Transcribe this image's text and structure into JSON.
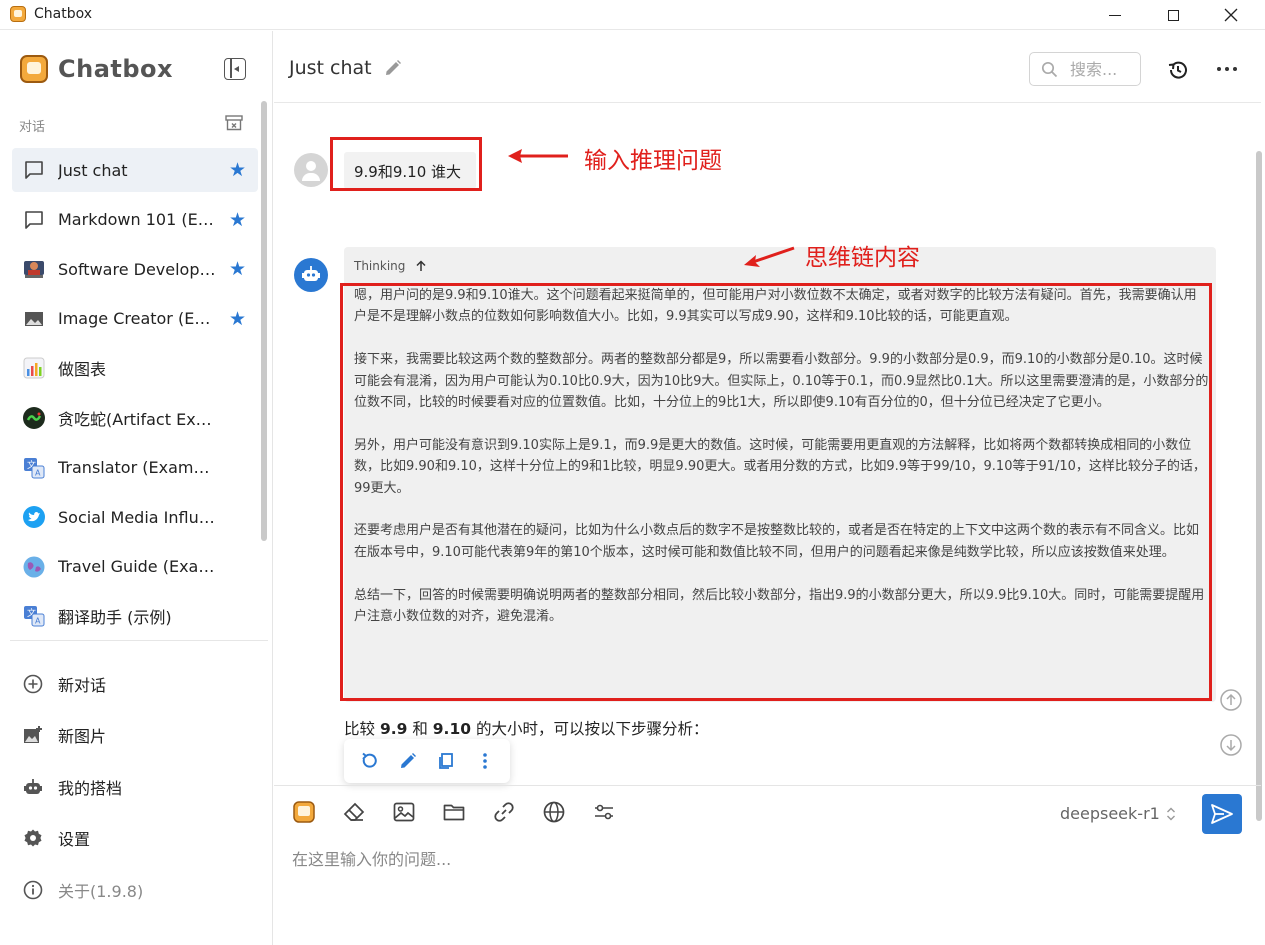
{
  "window": {
    "title": "Chatbox"
  },
  "sidebar": {
    "brand": "Chatbox",
    "section_label": "对话",
    "conversations": [
      {
        "label": "Just chat",
        "icon": "chat-bubble-icon",
        "starred": true,
        "active": true
      },
      {
        "label": "Markdown 101 (Example)",
        "icon": "chat-bubble-icon",
        "starred": true
      },
      {
        "label": "Software Developer (Example)",
        "icon": "developer-avatar-icon",
        "starred": true
      },
      {
        "label": "Image Creator (Example)",
        "icon": "image-icon",
        "starred": true
      },
      {
        "label": "做图表",
        "icon": "chart-icon",
        "starred": false
      },
      {
        "label": "贪吃蛇(Artifact Example)",
        "icon": "snake-game-icon",
        "starred": false
      },
      {
        "label": "Translator (Example)",
        "icon": "translate-icon",
        "starred": false
      },
      {
        "label": "Social Media Influencer (Example)",
        "icon": "twitter-icon",
        "starred": false
      },
      {
        "label": "Travel Guide (Example)",
        "icon": "globe-icon",
        "starred": false
      },
      {
        "label": "翻译助手 (示例)",
        "icon": "translate-icon",
        "starred": false
      }
    ],
    "nav": [
      {
        "label": "新对话",
        "icon": "plus-circle-icon"
      },
      {
        "label": "新图片",
        "icon": "add-image-icon"
      },
      {
        "label": "我的搭档",
        "icon": "robot-icon"
      },
      {
        "label": "设置",
        "icon": "gear-icon"
      },
      {
        "label": "关于(1.9.8)",
        "icon": "info-icon"
      }
    ]
  },
  "header": {
    "title": "Just chat",
    "search_placeholder": "搜索..."
  },
  "messages": {
    "user_question": "9.9和9.10 谁大",
    "thinking_label": "Thinking",
    "thinking_paragraphs": [
      "嗯，用户问的是9.9和9.10谁大。这个问题看起来挺简单的，但可能用户对小数位数不太确定，或者对数字的比较方法有疑问。首先，我需要确认用户是不是理解小数点的位数如何影响数值大小。比如，9.9其实可以写成9.90，这样和9.10比较的话，可能更直观。",
      "接下来，我需要比较这两个数的整数部分。两者的整数部分都是9，所以需要看小数部分。9.9的小数部分是0.9，而9.10的小数部分是0.10。这时候可能会有混淆，因为用户可能认为0.10比0.9大，因为10比9大。但实际上，0.10等于0.1，而0.9显然比0.1大。所以这里需要澄清的是，小数部分的位数不同，比较的时候要看对应的位置数值。比如，十分位上的9比1大，所以即使9.10有百分位的0，但十分位已经决定了它更小。",
      "另外，用户可能没有意识到9.10实际上是9.1，而9.9是更大的数值。这时候，可能需要用更直观的方法解释，比如将两个数都转换成相同的小数位数，比如9.90和9.10，这样十分位上的9和1比较，明显9.90更大。或者用分数的方式，比如9.9等于99/10，9.10等于91/10，这样比较分子的话，99更大。",
      "还要考虑用户是否有其他潜在的疑问，比如为什么小数点后的数字不是按整数比较的，或者是否在特定的上下文中这两个数的表示有不同含义。比如在版本号中，9.10可能代表第9年的第10个版本，这时候可能和数值比较不同，但用户的问题看起来像是纯数学比较，所以应该按数值来处理。",
      "总结一下，回答的时候需要明确说明两者的整数部分相同，然后比较小数部分，指出9.9的小数部分更大，所以9.9比9.10大。同时，可能需要提醒用户注意小数位数的对齐，避免混淆。"
    ],
    "answer_prefix": "比较 ",
    "answer_a": "9.9",
    "answer_mid": " 和 ",
    "answer_b": "9.10",
    "answer_suffix": " 的大小时，可以按以下步骤分析："
  },
  "annotations": {
    "question_note": "输入推理问题",
    "thinking_note": "思维链内容",
    "color": "#e0201c"
  },
  "composer": {
    "model": "deepseek-r1",
    "placeholder": "在这里输入你的问题..."
  },
  "colors": {
    "accent": "#2a78d2",
    "annotation": "#e0201c"
  }
}
